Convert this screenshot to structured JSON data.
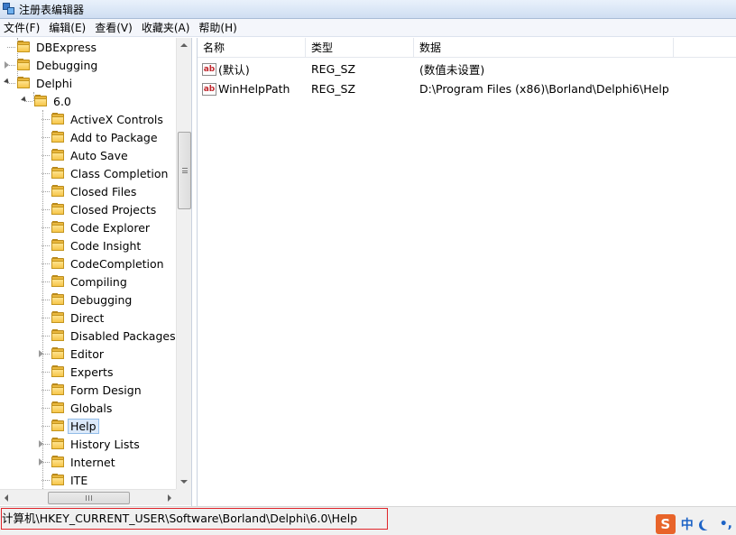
{
  "window": {
    "title": "注册表编辑器"
  },
  "menu": [
    {
      "id": "file",
      "label": "文件(F)"
    },
    {
      "id": "edit",
      "label": "编辑(E)"
    },
    {
      "id": "view",
      "label": "查看(V)"
    },
    {
      "id": "favorites",
      "label": "收藏夹(A)"
    },
    {
      "id": "help",
      "label": "帮助(H)"
    }
  ],
  "tree": {
    "items": [
      {
        "label": "DBExpress",
        "level": 0,
        "expander": "none"
      },
      {
        "label": "Debugging",
        "level": 0,
        "expander": "closed"
      },
      {
        "label": "Delphi",
        "level": 0,
        "expander": "open"
      },
      {
        "label": "6.0",
        "level": 1,
        "expander": "open"
      },
      {
        "label": "ActiveX Controls",
        "level": 2,
        "expander": "none"
      },
      {
        "label": "Add to Package",
        "level": 2,
        "expander": "none"
      },
      {
        "label": "Auto Save",
        "level": 2,
        "expander": "none"
      },
      {
        "label": "Class Completion",
        "level": 2,
        "expander": "none"
      },
      {
        "label": "Closed Files",
        "level": 2,
        "expander": "none"
      },
      {
        "label": "Closed Projects",
        "level": 2,
        "expander": "none"
      },
      {
        "label": "Code Explorer",
        "level": 2,
        "expander": "none"
      },
      {
        "label": "Code Insight",
        "level": 2,
        "expander": "none"
      },
      {
        "label": "CodeCompletion",
        "level": 2,
        "expander": "none"
      },
      {
        "label": "Compiling",
        "level": 2,
        "expander": "none"
      },
      {
        "label": "Debugging",
        "level": 2,
        "expander": "none"
      },
      {
        "label": "Direct",
        "level": 2,
        "expander": "none"
      },
      {
        "label": "Disabled Packages",
        "level": 2,
        "expander": "none"
      },
      {
        "label": "Editor",
        "level": 2,
        "expander": "closed"
      },
      {
        "label": "Experts",
        "level": 2,
        "expander": "none"
      },
      {
        "label": "Form Design",
        "level": 2,
        "expander": "none"
      },
      {
        "label": "Globals",
        "level": 2,
        "expander": "none"
      },
      {
        "label": "Help",
        "level": 2,
        "expander": "none",
        "selected": true
      },
      {
        "label": "History Lists",
        "level": 2,
        "expander": "closed"
      },
      {
        "label": "Internet",
        "level": 2,
        "expander": "closed"
      },
      {
        "label": "ITE",
        "level": 2,
        "expander": "none"
      }
    ]
  },
  "list": {
    "columns": [
      "名称",
      "类型",
      "数据"
    ],
    "rows": [
      {
        "name": "(默认)",
        "type": "REG_SZ",
        "data": "(数值未设置)",
        "icon": "string-value-icon"
      },
      {
        "name": "WinHelpPath",
        "type": "REG_SZ",
        "data": "D:\\Program Files (x86)\\Borland\\Delphi6\\Help",
        "icon": "string-value-icon"
      }
    ]
  },
  "status": {
    "path": "计算机\\HKEY_CURRENT_USER\\Software\\Borland\\Delphi\\6.0\\Help"
  },
  "ime": {
    "logo": "S",
    "mode": "中",
    "punct": "•,"
  }
}
